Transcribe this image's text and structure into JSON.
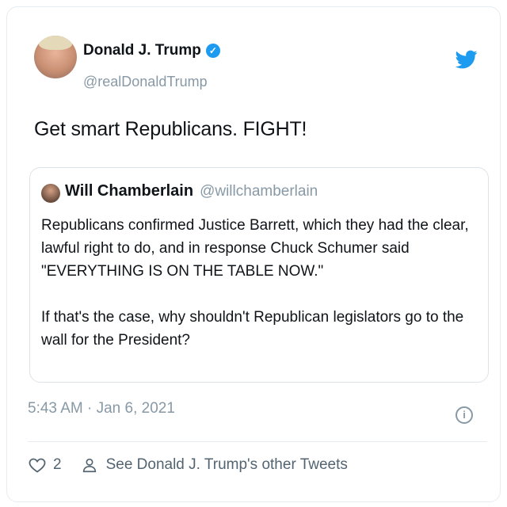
{
  "tweet": {
    "author_name": "Donald J. Trump",
    "handle": "@realDonaldTrump",
    "text": "Get smart Republicans. FIGHT!",
    "timestamp": "5:43 AM · Jan 6, 2021",
    "like_count": "2",
    "other_tweets_link": "See Donald J. Trump's other Tweets"
  },
  "quote": {
    "author_name": "Will Chamberlain",
    "handle": "@willchamberlain",
    "paragraphs": [
      "Republicans confirmed Justice Barrett, which they had the clear, lawful right to do, and in response Chuck Schumer said \"EVERYTHING IS ON THE TABLE NOW.\"",
      "If that's the case, why shouldn't Republican legislators go to the wall for the President?"
    ]
  },
  "icons": {
    "bird": "twitter-bird-icon",
    "verified": "verified-badge-icon",
    "info": "info-icon",
    "heart": "heart-icon",
    "person": "person-icon"
  },
  "colors": {
    "accent": "#1d9bf0",
    "muted": "#8899a6",
    "border": "#e6ecf0"
  }
}
